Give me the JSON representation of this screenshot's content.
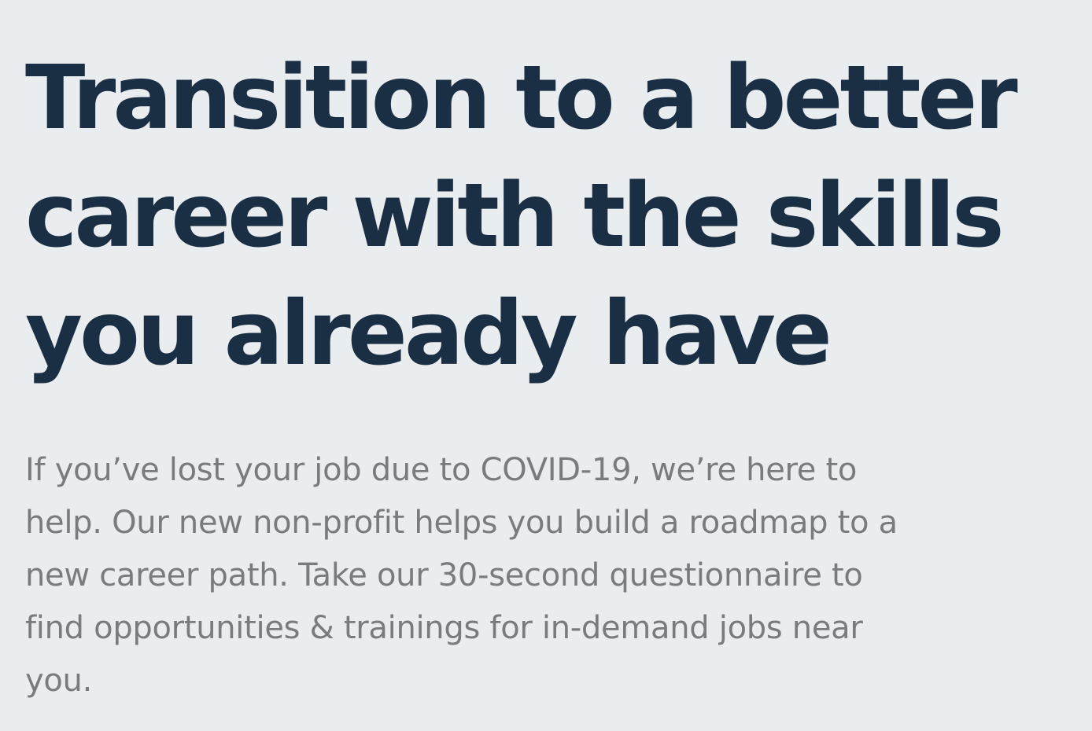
{
  "hero": {
    "title_lines": [
      "Transition to a better",
      "career with the skills",
      "you already have"
    ],
    "subtitle_lines": [
      "If you’ve lost your job due to COVID-19, we’re here to",
      "help. Our new non-profit helps you build a roadmap to a",
      "new career path. Take our 30-second questionnaire to",
      "find opportunities & trainings for in-demand jobs near",
      "you."
    ]
  },
  "colors": {
    "background": "#e9edf0",
    "title": "#1b2f44",
    "subtitle": "#7a7b7d"
  }
}
